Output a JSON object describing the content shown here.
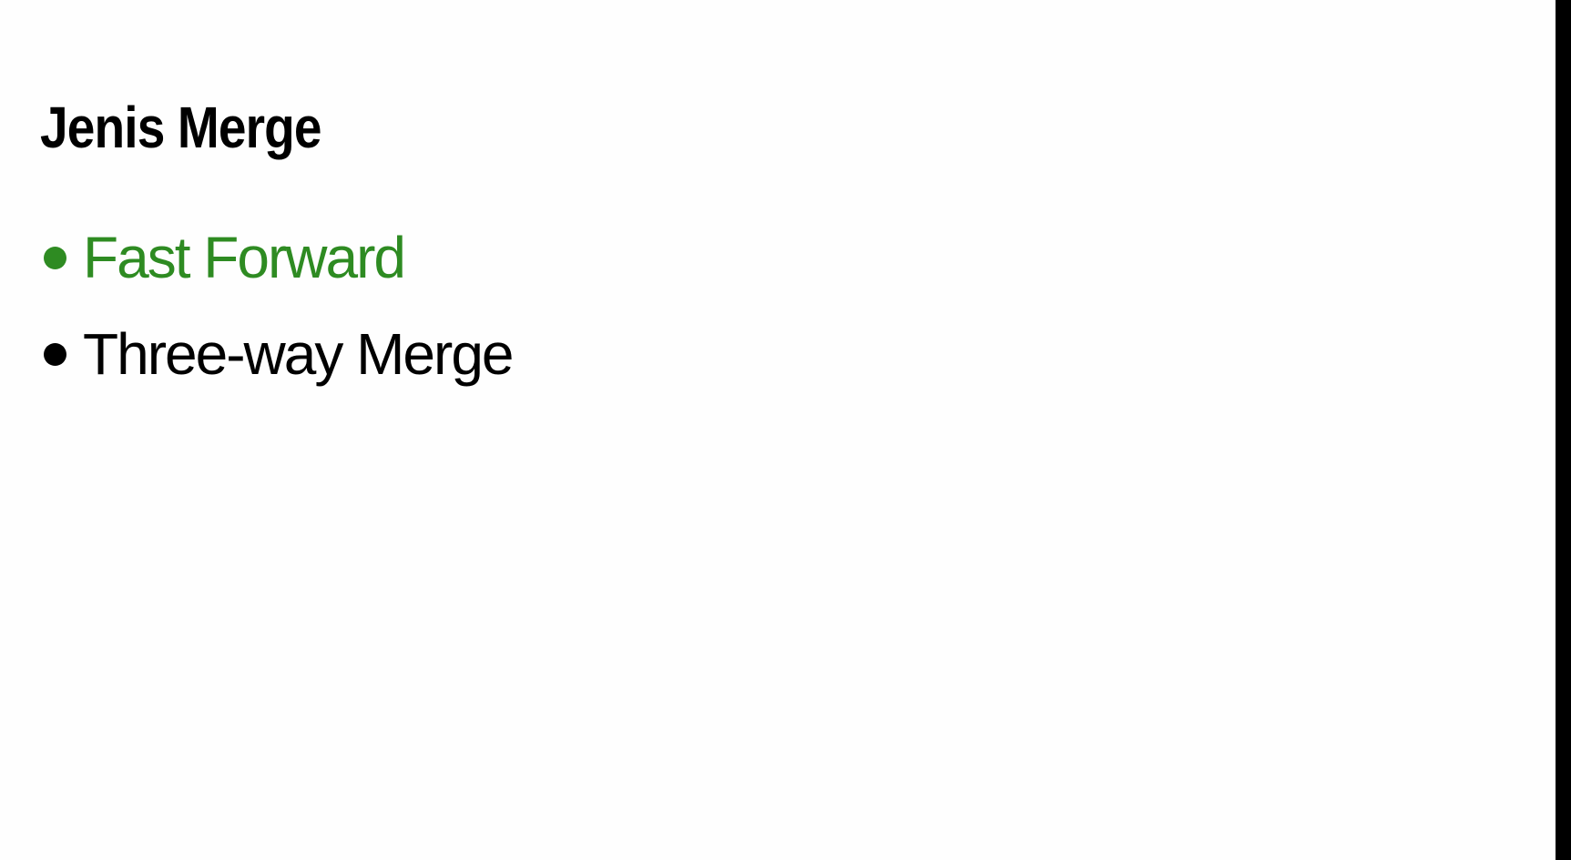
{
  "slide": {
    "title": "Jenis Merge",
    "bullets": [
      {
        "label": "Fast Forward",
        "color": "#2e8b22"
      },
      {
        "label": "Three-way Merge",
        "color": "#000000"
      }
    ]
  }
}
